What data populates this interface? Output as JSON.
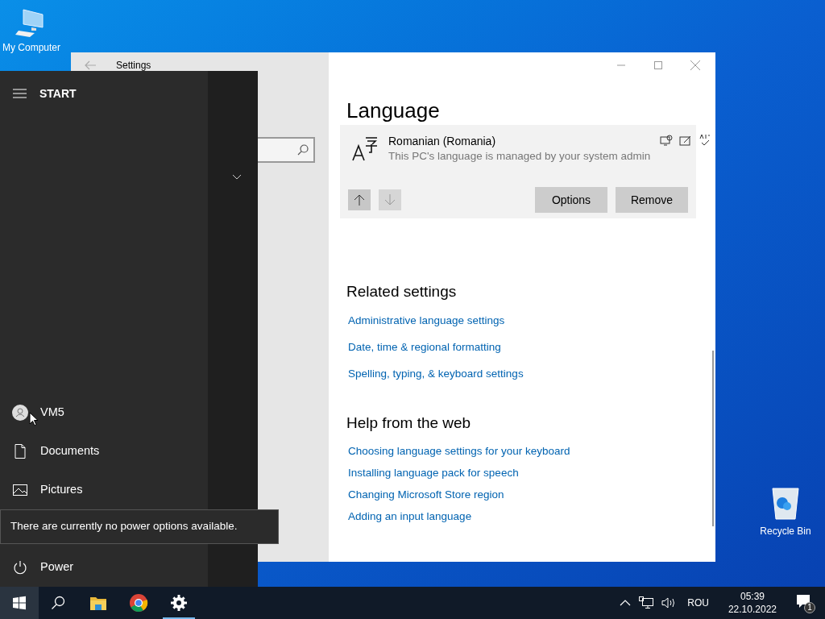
{
  "desktop_icons": [
    {
      "label": "My Computer",
      "kind": "computer"
    },
    {
      "label": "Recycle Bin",
      "kind": "recycle"
    }
  ],
  "settings_window": {
    "title": "Settings",
    "page_title": "Language",
    "language_card": {
      "name": "Romanian (Romania)",
      "note": "This PC's language is managed by your system admin",
      "buttons": [
        "Options",
        "Remove"
      ]
    },
    "related": {
      "heading": "Related settings",
      "links": [
        "Administrative language settings",
        "Date, time & regional formatting",
        "Spelling, typing, & keyboard settings"
      ]
    },
    "help": {
      "heading": "Help from the web",
      "links": [
        "Choosing language settings for your keyboard",
        "Installing language pack for speech",
        "Changing Microsoft Store region",
        "Adding an input language"
      ]
    }
  },
  "start_menu": {
    "title": "START",
    "items": [
      {
        "label": "VM5",
        "kind": "user"
      },
      {
        "label": "Documents",
        "kind": "document"
      },
      {
        "label": "Pictures",
        "kind": "pictures"
      },
      {
        "label": "Power",
        "kind": "power"
      }
    ],
    "tooltip": "There are currently no power options available."
  },
  "taskbar": {
    "apps": [
      {
        "kind": "start",
        "active": false
      },
      {
        "kind": "search",
        "active": false
      },
      {
        "kind": "explorer",
        "active": false
      },
      {
        "kind": "chrome",
        "active": false
      },
      {
        "kind": "settings",
        "active": true
      }
    ],
    "language": "ROU",
    "time": "05:39",
    "date": "22.10.2022",
    "notification_count": "1"
  }
}
